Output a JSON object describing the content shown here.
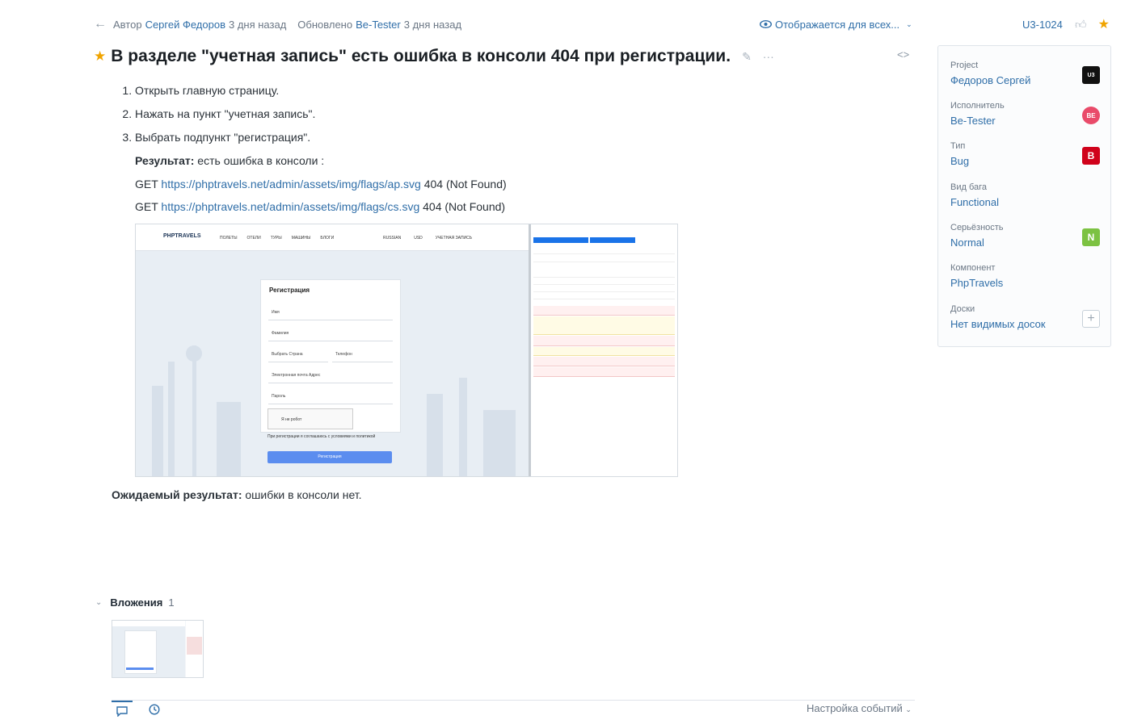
{
  "meta": {
    "author_prefix": "Автор",
    "author": "Сергей Федоров",
    "author_time": "3 дня назад",
    "updated_prefix": "Обновлено",
    "updater": "Be-Tester",
    "updated_time": "3 дня назад",
    "visibility": "Отображается для всех...",
    "issue_id": "U3-1024"
  },
  "issue": {
    "title": "В разделе \"учетная запись\" есть ошибка в консоли 404 при регистрации."
  },
  "description": {
    "steps": [
      "Открыть главную страницу.",
      "Нажать на пункт \"учетная запись\".",
      "Выбрать подпункт \"регистрация\"."
    ],
    "result_label": "Результат:",
    "result_text": " есть ошибка в консоли :",
    "errors": [
      {
        "method": "GET ",
        "url": "https://phptravels.net/admin/assets/img/flags/ap.svg",
        "status": " 404 (Not Found)"
      },
      {
        "method": "GET ",
        "url": "https://phptravels.net/admin/assets/img/flags/cs.svg",
        "status": " 404 (Not Found)"
      }
    ],
    "expected_label": "Ожидаемый результат:",
    "expected_text": " ошибки в консоли нет."
  },
  "screenshot": {
    "brand": "PHPTRAVELS",
    "nav_items": [
      "ПОЛЕТЫ",
      "ОТЕЛИ",
      "ТУРЫ",
      "МАШИНЫ",
      "БЛОГИ"
    ],
    "lang": "RUSSIAN",
    "currency": "USD",
    "account": "УЧЕТНАЯ ЗАПИСЬ",
    "form_title": "Регистрация",
    "fields": [
      "Имя",
      "Фамилия",
      "Выбрать Страна",
      "Телефон",
      "Электронная почта Адрес",
      "Пароль"
    ],
    "captcha": "Я не робот",
    "terms": "При регистрации я соглашаюсь с условиями и политикой",
    "submit": "Регистрация"
  },
  "attachments": {
    "label": "Вложения",
    "count": "1"
  },
  "footer": {
    "events_settings": "Настройка событий"
  },
  "sidebar": {
    "fields": [
      {
        "label": "Project",
        "value": "Федоров Сергей",
        "badge": "U3",
        "badge_color": "#111111"
      },
      {
        "label": "Исполнитель",
        "value": "Be-Tester",
        "badge": "BE",
        "badge_color": "#e94b6a"
      },
      {
        "label": "Тип",
        "value": "Bug",
        "badge": "B",
        "badge_color": "#d0021b"
      },
      {
        "label": "Вид бага",
        "value": "Functional",
        "badge": "",
        "badge_color": ""
      },
      {
        "label": "Серьёзность",
        "value": "Normal",
        "badge": "N",
        "badge_color": "#7cc242"
      },
      {
        "label": "Компонент",
        "value": "PhpTravels",
        "badge": "",
        "badge_color": ""
      },
      {
        "label": "Доски",
        "value": "Нет видимых досок",
        "badge": "+",
        "badge_color": ""
      }
    ]
  }
}
